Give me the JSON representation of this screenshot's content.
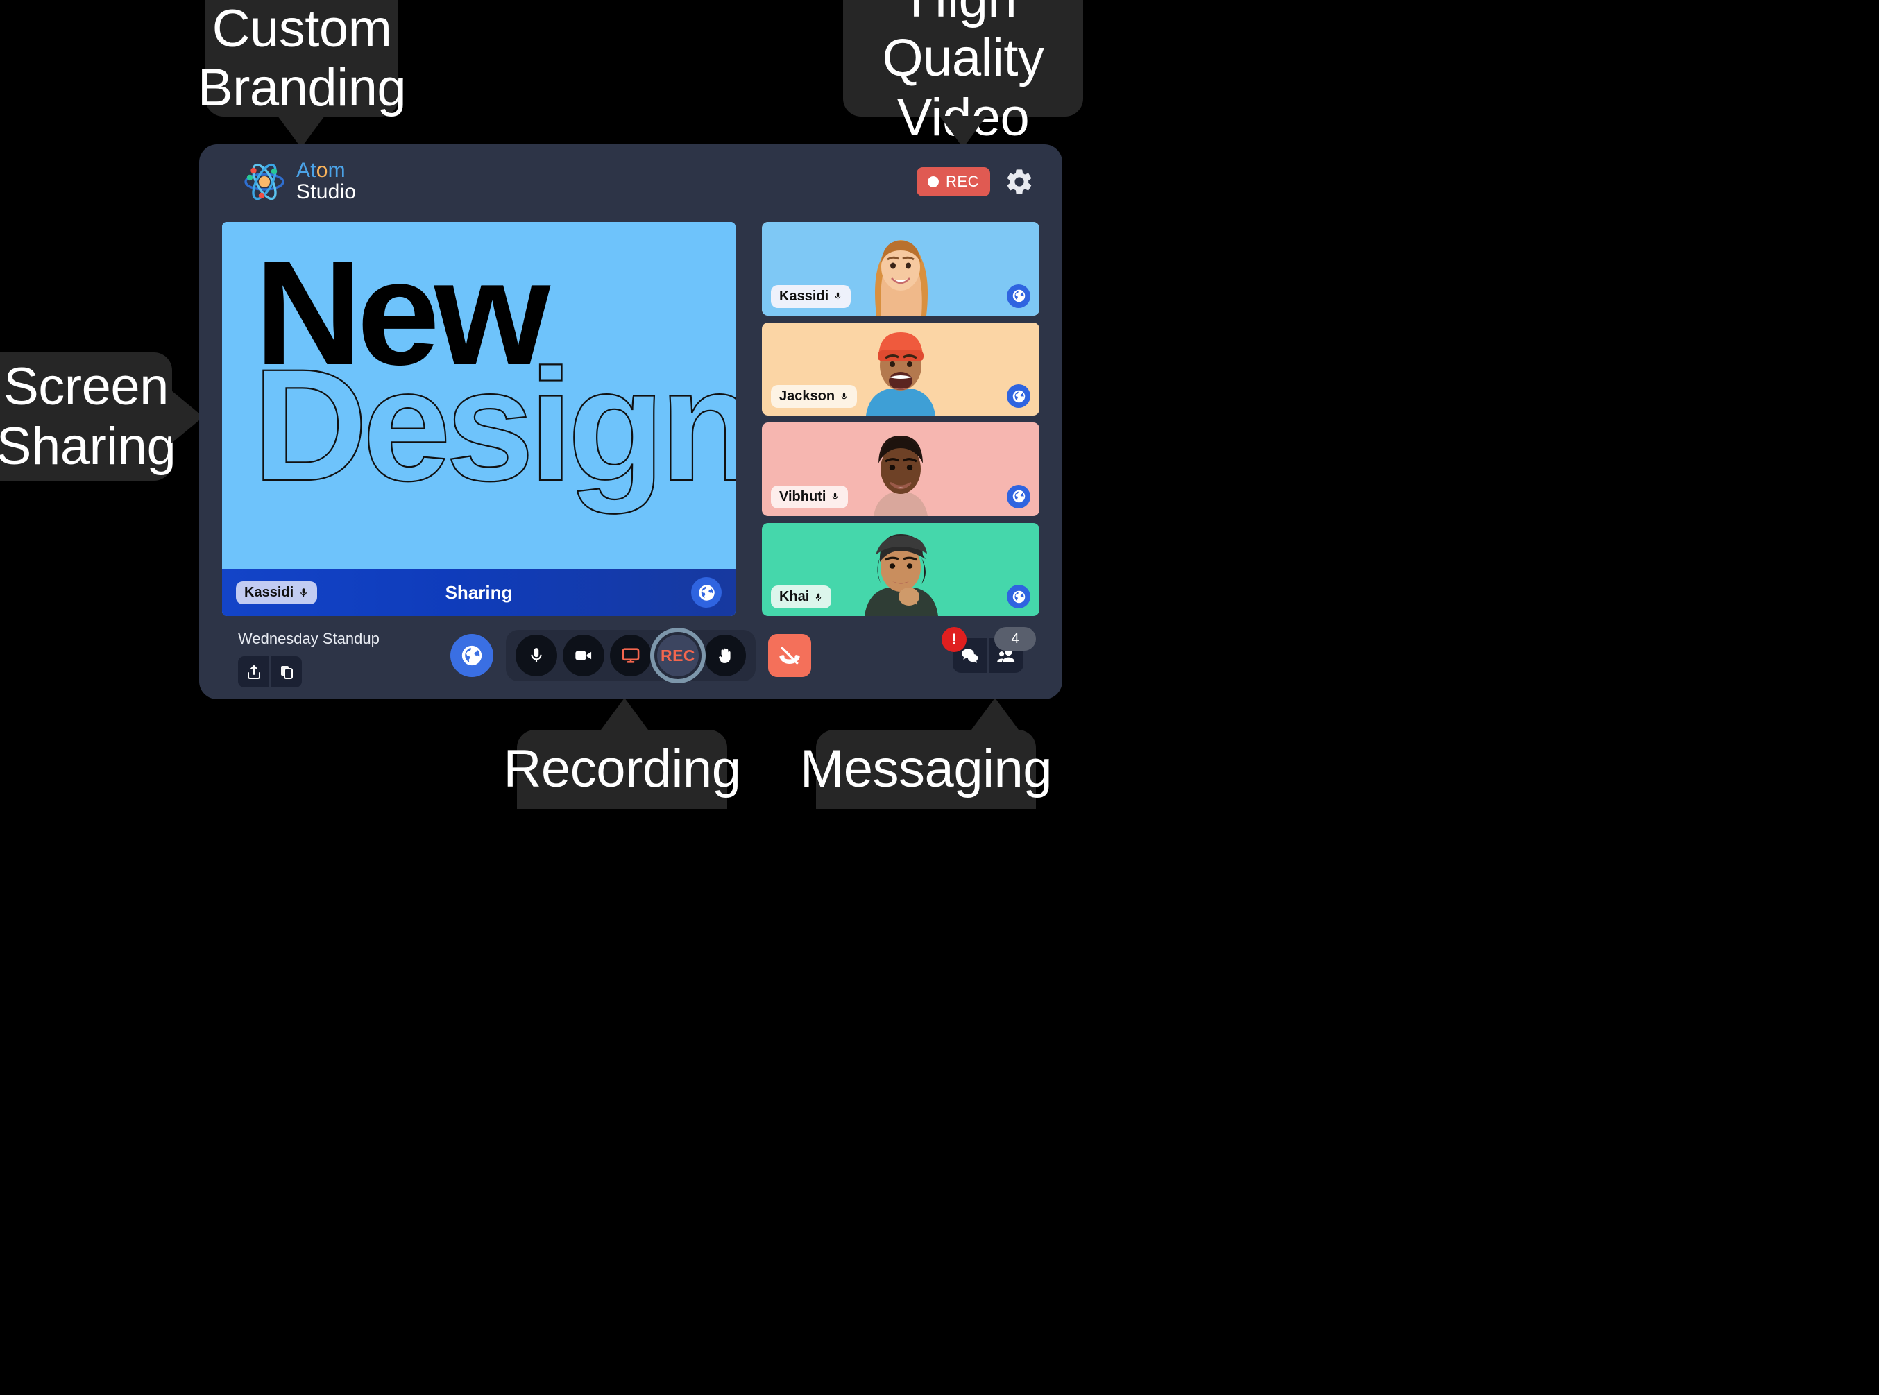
{
  "callouts": [
    {
      "id": "brand",
      "label": "Custom\nBranding"
    },
    {
      "id": "hq",
      "label": "High Quality\nVideo"
    },
    {
      "id": "screen",
      "label": "Screen\nSharing"
    },
    {
      "id": "recording",
      "label": "Recording"
    },
    {
      "id": "messaging",
      "label": "Messaging"
    }
  ],
  "app": {
    "brand": {
      "line1": "At",
      "dot": "o",
      "line1b": "m",
      "line2": "Studio",
      "icon": "atom-icon"
    },
    "header": {
      "rec_label": "REC",
      "rec_color": "#e05a52",
      "settings_icon": "gear-icon"
    },
    "stage": {
      "slide_line1": "New",
      "slide_line2": "Design",
      "slide_bg": "#6ec3fb",
      "presenter_name": "Kassidi",
      "mic_icon": "microphone-icon",
      "status": "Sharing",
      "globe_icon": "globe-icon"
    },
    "participants": [
      {
        "name": "Kassidi",
        "bg": "#7ec8f5",
        "tag_bg": "#eef1fb",
        "active": true,
        "mic_icon": "microphone-icon",
        "globe_icon": "globe-icon"
      },
      {
        "name": "Jackson",
        "bg": "#fbd5a5",
        "tag_bg": "#fdf3e4",
        "active": false,
        "mic_icon": "microphone-icon",
        "globe_icon": "globe-icon"
      },
      {
        "name": "Vibhuti",
        "bg": "#f6b6b0",
        "tag_bg": "#fdeeec",
        "active": false,
        "mic_icon": "microphone-icon",
        "globe_icon": "globe-icon"
      },
      {
        "name": "Khai",
        "bg": "#45d7ab",
        "tag_bg": "#dcf6ec",
        "active": false,
        "mic_icon": "microphone-icon",
        "globe_icon": "globe-icon"
      }
    ],
    "footer": {
      "meeting_title": "Wednesday Standup",
      "share_icon": "share-upload-icon",
      "copy_icon": "copy-icon",
      "globe_icon": "globe-icon",
      "mic_icon": "microphone-icon",
      "camera_icon": "video-camera-icon",
      "screen_icon": "monitor-screen-icon",
      "rec_label": "REC",
      "rec_text_color": "#f4664e",
      "hand_icon": "raise-hand-icon",
      "leave_icon": "phone-hangup-icon",
      "leave_color": "#f4705a",
      "chat_icon": "chat-bubbles-icon",
      "participants_icon": "people-icon",
      "alert_badge": "!",
      "participant_count": "4"
    }
  }
}
